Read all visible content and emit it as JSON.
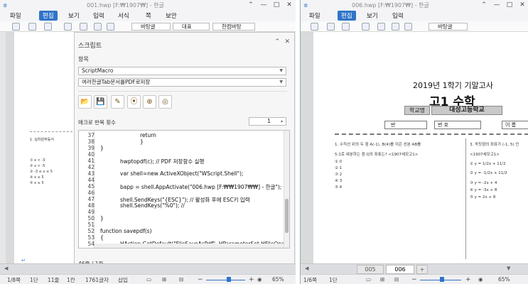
{
  "left_window": {
    "title": "001.hwp [F:₩1907₩] - 한글",
    "menu": {
      "file": "파일",
      "edit": "편집",
      "view": "보기",
      "input": "입력",
      "format": "서식",
      "page": "쪽",
      "security": "보안"
    },
    "toolbar": {
      "style_combo": "바탕글",
      "font_size_combo": "대표",
      "font_combo": "한컴바탕"
    },
    "doc_lines": [
      "1. 실차원부등식",
      "① x < -3",
      "② x > -5",
      "③ -3 ≤ x ≤ 5",
      "④ x ≤ 5",
      "⑤ x ≥ 5"
    ],
    "status": {
      "page": "1/8쪽",
      "section": "1단",
      "line": "11줄",
      "col": "1칸",
      "chars": "1761글자",
      "mode": "삽입"
    }
  },
  "script_panel": {
    "title": "스크립트",
    "item_label": "항목",
    "item_select": "ScriptMacro",
    "macro_select": "여러한글Tab문서를PDF로저장",
    "repeat_label": "매크로 반복 횟수",
    "repeat_value": "1",
    "icons": [
      "open-folder-icon",
      "save-icon",
      "script-edit-icon",
      "record-icon",
      "add-macro-icon",
      "run-macro-icon"
    ],
    "code_lines": [
      {
        "n": "37",
        "text": "return",
        "indent": 2
      },
      {
        "n": "38",
        "text": "}",
        "indent": 2
      },
      {
        "n": "39",
        "text": "}",
        "indent": 0
      },
      {
        "n": "40",
        "text": "",
        "indent": 0
      },
      {
        "n": "41",
        "text": "hwptopdf(c); // PDF 저장함수 실행",
        "indent": 1
      },
      {
        "n": "42",
        "text": "",
        "indent": 0
      },
      {
        "n": "43",
        "text": "var shell=new ActiveXObject(\"WScript.Shell\");",
        "indent": 1
      },
      {
        "n": "44",
        "text": "",
        "indent": 0
      },
      {
        "n": "45",
        "text": "bapp = shell.AppActivate(\"006.hwp [F:₩₩1907₩₩] - 한글\");",
        "indent": 1
      },
      {
        "n": "46",
        "text": "",
        "indent": 0
      },
      {
        "n": "47",
        "text": "shell.SendKeys(\"{ESC}\"); // 활성화 후에 ESC키 입력",
        "indent": 1
      },
      {
        "n": "48",
        "text": "shell.SendKeys(\"%0\"); //",
        "indent": 1
      },
      {
        "n": "49",
        "text": "",
        "indent": 0
      },
      {
        "n": "50",
        "text": "}",
        "indent": 0
      },
      {
        "n": "51",
        "text": "",
        "indent": 0
      },
      {
        "n": "52",
        "text": "function savepdf(s)",
        "indent": 0
      },
      {
        "n": "53",
        "text": "{",
        "indent": 0
      },
      {
        "n": "54",
        "text": "HAction.GetDefault(\"FileSaveAsPdf\", HParameterSet.HFileOpenSa",
        "indent": 1
      }
    ],
    "position": "46줄 / 1칸"
  },
  "right_window": {
    "title": "006.hwp [F:₩1907₩] - 한글",
    "menu": {
      "file": "파일",
      "edit": "편집",
      "view": "보기",
      "input": "입력"
    },
    "toolbar": {
      "style_combo": "바탕글"
    },
    "doc": {
      "exam_title": "2019년 1학기 기말고사",
      "subject": "고1 수학",
      "school_label": "학교명",
      "school_name": "대성고등학교",
      "class_label": "반",
      "number_label": "번 호",
      "name_label": "이 름",
      "q1": "1. 수직선 위의 두 점 A(-1), B(4)를 이은 선분 AB를",
      "q1b": "5:1로 내분하는 점 Q의 좌표는? <1907세모고1>",
      "q1_choices": [
        "① 0",
        "② 1",
        "③ 2",
        "④ 3",
        "⑤ 4"
      ],
      "q3": "3. 꼭짓점의 좌표가 (-1, 5) 인",
      "q3b": "<1907세모고1>",
      "q3_choices": [
        "① y = 1/2x + 11/2",
        "② y = -1/2x + 11/2",
        "③ y = -2x + 4",
        "④ y = -3x + 8",
        "⑤ y = 2x + 8"
      ]
    },
    "tabs": [
      "005",
      "006",
      "+"
    ],
    "status": {
      "page": "1/6쪽",
      "section": "1단",
      "zoom": "65%"
    }
  },
  "left_zoom": "65%"
}
